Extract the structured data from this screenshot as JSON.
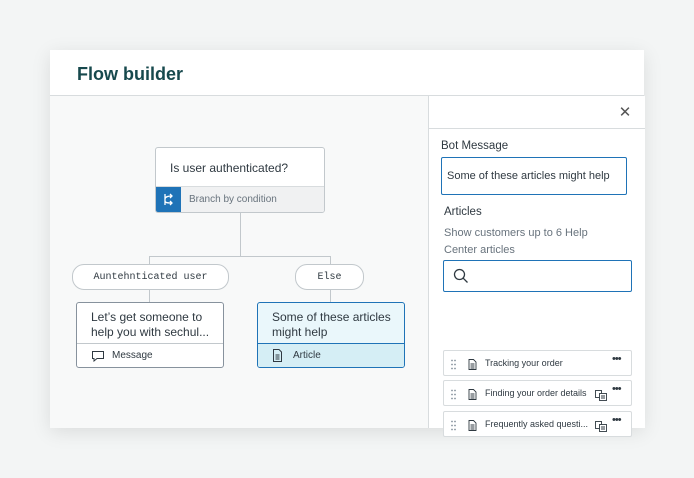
{
  "header": {
    "title": "Flow builder"
  },
  "canvas": {
    "condition_node": {
      "question": "Is user authenticated?",
      "footer_label": "Branch by condition"
    },
    "branches": [
      {
        "label": "Auntehnticated user"
      },
      {
        "label": "Else"
      }
    ],
    "cards": [
      {
        "text_line1": "Let’s get someone to",
        "text_line2": "help you with sechul...",
        "footer_label": "Message",
        "icon": "chat-bubble-icon"
      },
      {
        "text_line1": "Some of these articles",
        "text_line2": "might help",
        "footer_label": "Article",
        "icon": "document-icon"
      }
    ]
  },
  "panel": {
    "close_icon": "close-icon",
    "bot_message_label": "Bot Message",
    "bot_message_value": "Some of these articles might help",
    "articles_label": "Articles",
    "articles_help_line1": "Show customers up to 6 Help",
    "articles_help_line2": "Center articles",
    "search_placeholder": "",
    "articles": [
      {
        "title": "Tracking your order",
        "has_copy_icon": false
      },
      {
        "title": "Finding your order details",
        "has_copy_icon": true
      },
      {
        "title": "Frequently asked questi...",
        "has_copy_icon": true
      }
    ]
  },
  "colors": {
    "accent": "#1f73b7",
    "title": "#17494d",
    "active_card_bg": "#eaf7fb"
  }
}
